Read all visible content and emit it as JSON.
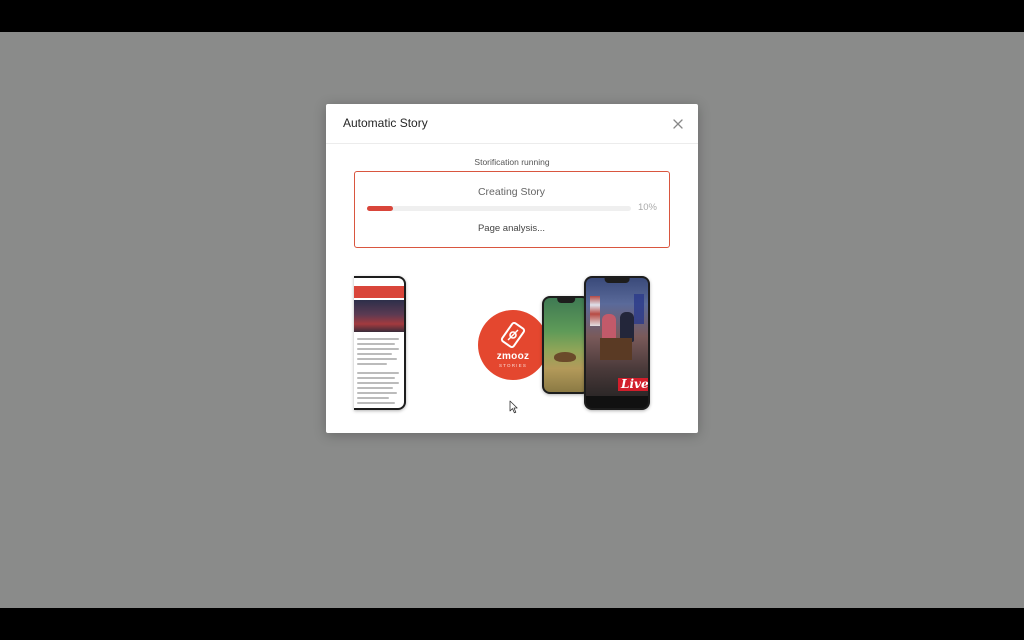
{
  "modal": {
    "title": "Automatic Story",
    "close_icon": "close-icon"
  },
  "status": {
    "label": "Storification running"
  },
  "progress": {
    "heading": "Creating Story",
    "percent": 10,
    "percent_label": "10%",
    "step": "Page analysis..."
  },
  "brand": {
    "name": "zmooz",
    "tagline": "STORIES",
    "color": "#e4472f"
  },
  "illustration": {
    "live_badge": "Live"
  },
  "colors": {
    "accent": "#d9453a",
    "overlay": "#8a8b8a"
  }
}
